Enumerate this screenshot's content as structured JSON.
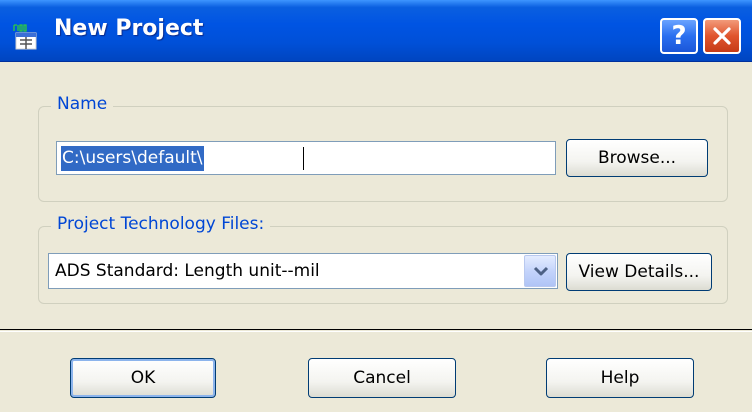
{
  "window": {
    "title": "New Project",
    "app_icon": "100-percent-grid-icon",
    "controls": {
      "help": "?",
      "close": "close-icon"
    }
  },
  "name_group": {
    "legend": "Name",
    "path_value": "C:\\users\\default\\",
    "browse_label": "Browse..."
  },
  "tech_group": {
    "legend": "Project Technology Files:",
    "selected_value": "ADS Standard: Length unit--mil",
    "view_details_label": "View Details..."
  },
  "footer": {
    "ok_label": "OK",
    "cancel_label": "Cancel",
    "help_label": "Help"
  },
  "colors": {
    "titlebar": "#0054e3",
    "legend_text": "#0046d5",
    "selection": "#316ac5",
    "dialog_bg": "#ece9d8",
    "close_button": "#e0552e"
  }
}
